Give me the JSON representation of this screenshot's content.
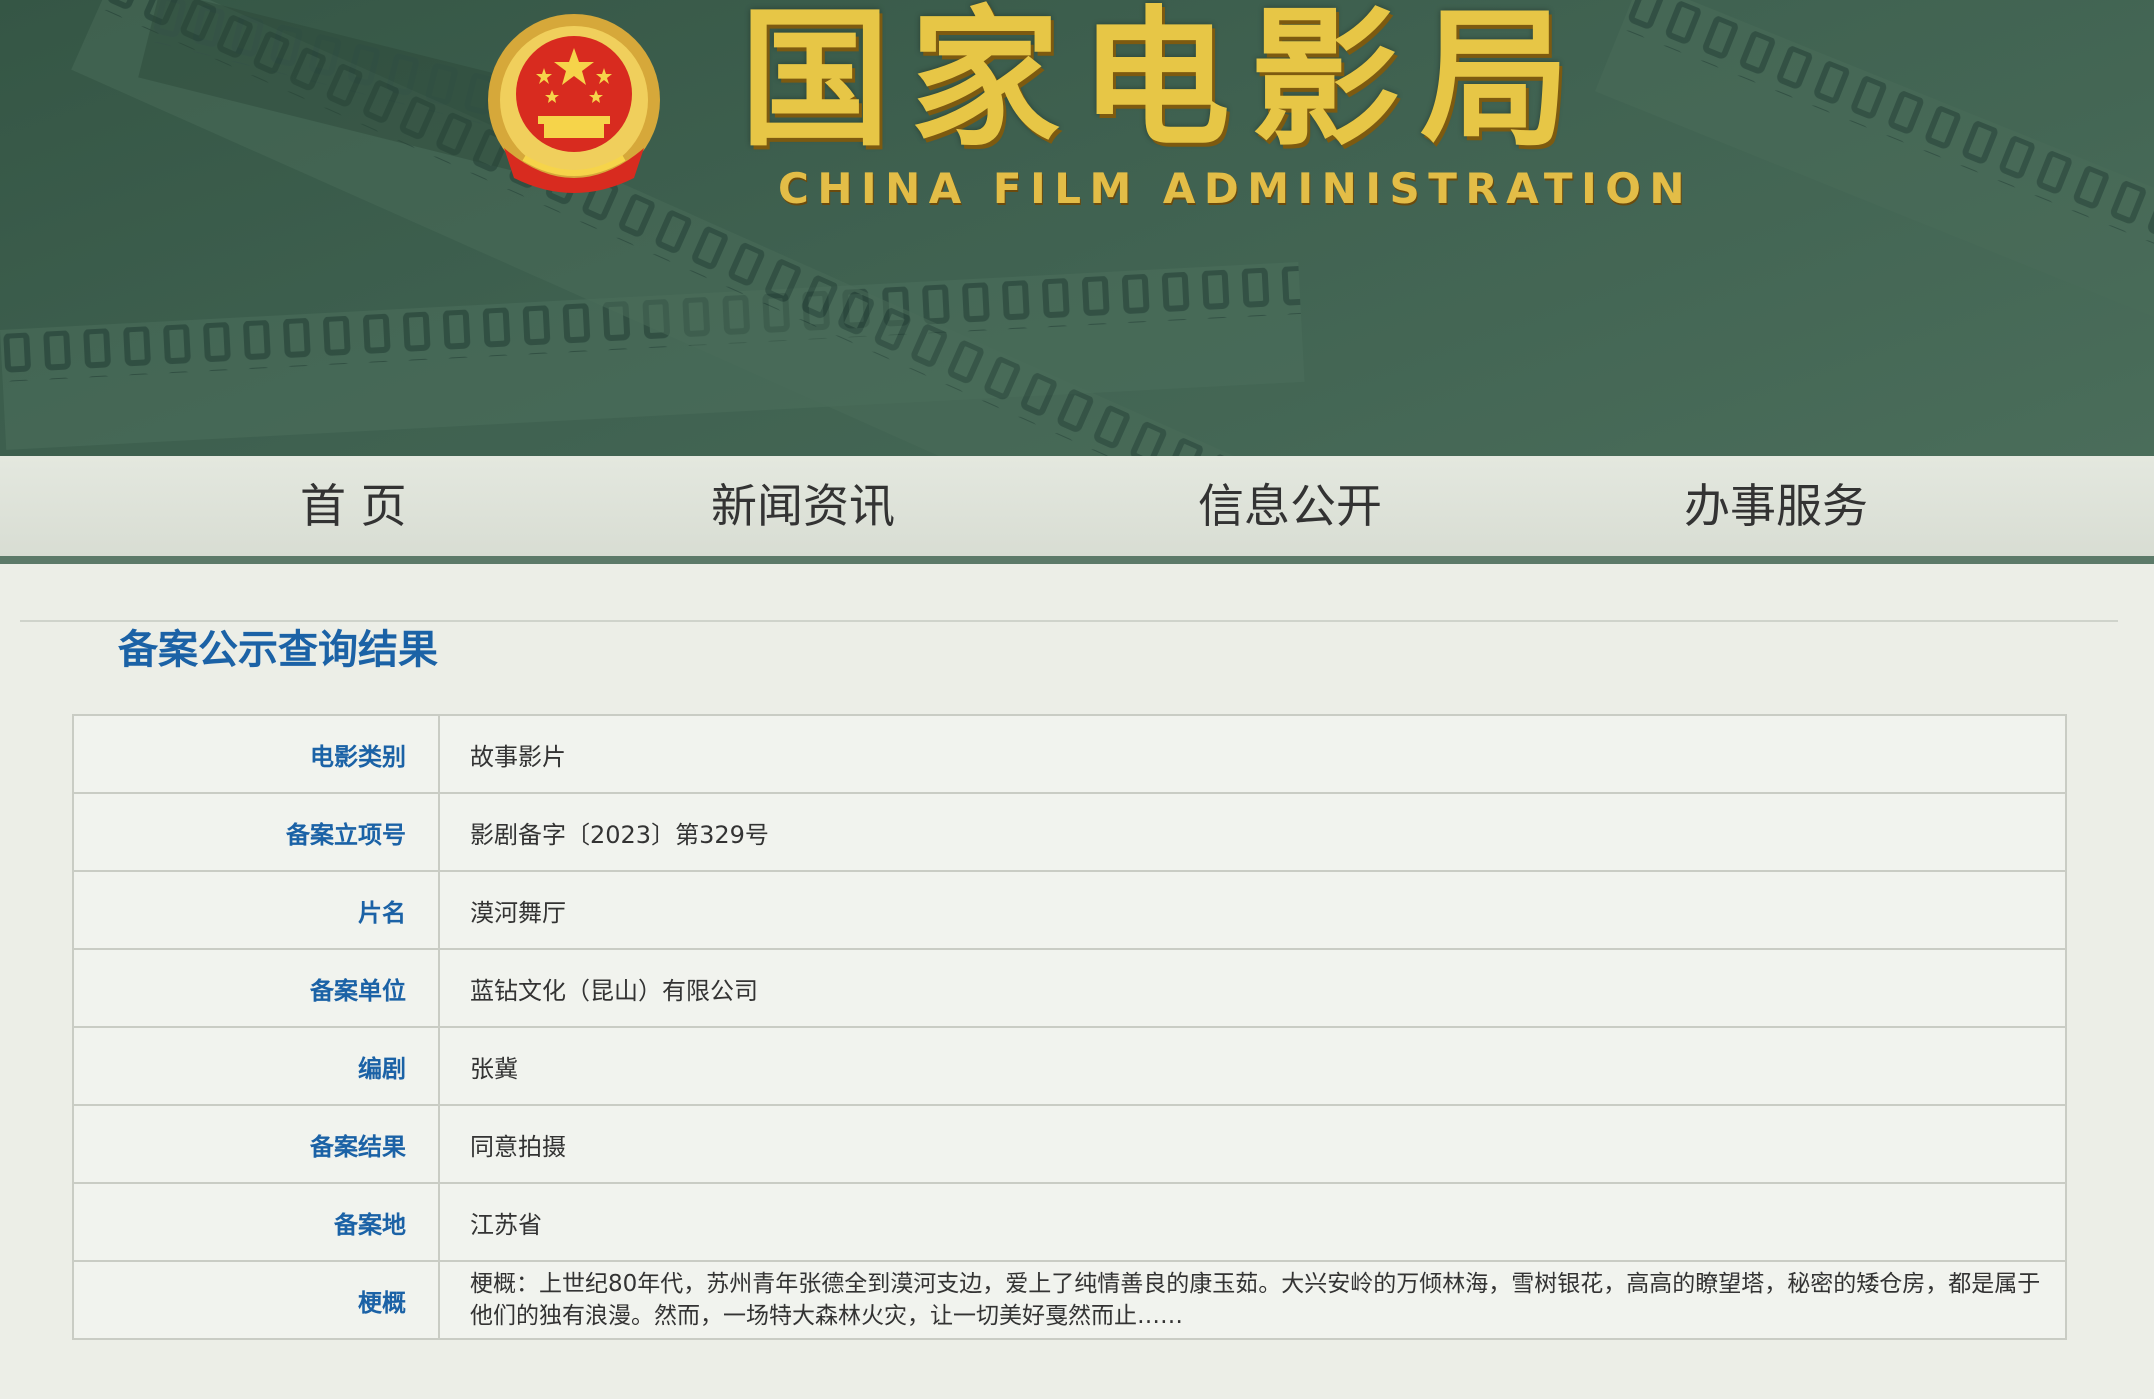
{
  "header": {
    "title_cn": "国家电影局",
    "title_en": "CHINA FILM ADMINISTRATION"
  },
  "nav": {
    "items": [
      {
        "label": "首 页"
      },
      {
        "label": "新闻资讯"
      },
      {
        "label": "信息公开"
      },
      {
        "label": "办事服务"
      }
    ]
  },
  "main": {
    "title": "备案公示查询结果",
    "rows": [
      {
        "label": "电影类别",
        "value": "故事影片"
      },
      {
        "label": "备案立项号",
        "value": "影剧备字〔2023〕第329号"
      },
      {
        "label": "片名",
        "value": "漠河舞厅"
      },
      {
        "label": "备案单位",
        "value": "蓝钻文化（昆山）有限公司"
      },
      {
        "label": "编剧",
        "value": "张冀"
      },
      {
        "label": "备案结果",
        "value": "同意拍摄"
      },
      {
        "label": "备案地",
        "value": "江苏省"
      },
      {
        "label": "梗概",
        "value": "梗概：上世纪80年代，苏州青年张德全到漠河支边，爱上了纯情善良的康玉茹。大兴安岭的万倾林海，雪树银花，高高的瞭望塔，秘密的矮仓房，都是属于他们的独有浪漫。然而，一场特大森林火灾，让一切美好戛然而止……"
      }
    ]
  },
  "colors": {
    "banner_green": "#3f6150",
    "gold": "#e7c646",
    "title_blue": "#1b62a6",
    "nav_underline": "#5c7a69"
  },
  "icons": {
    "emblem": "national-emblem-icon",
    "film": "film-strip-decoration"
  }
}
